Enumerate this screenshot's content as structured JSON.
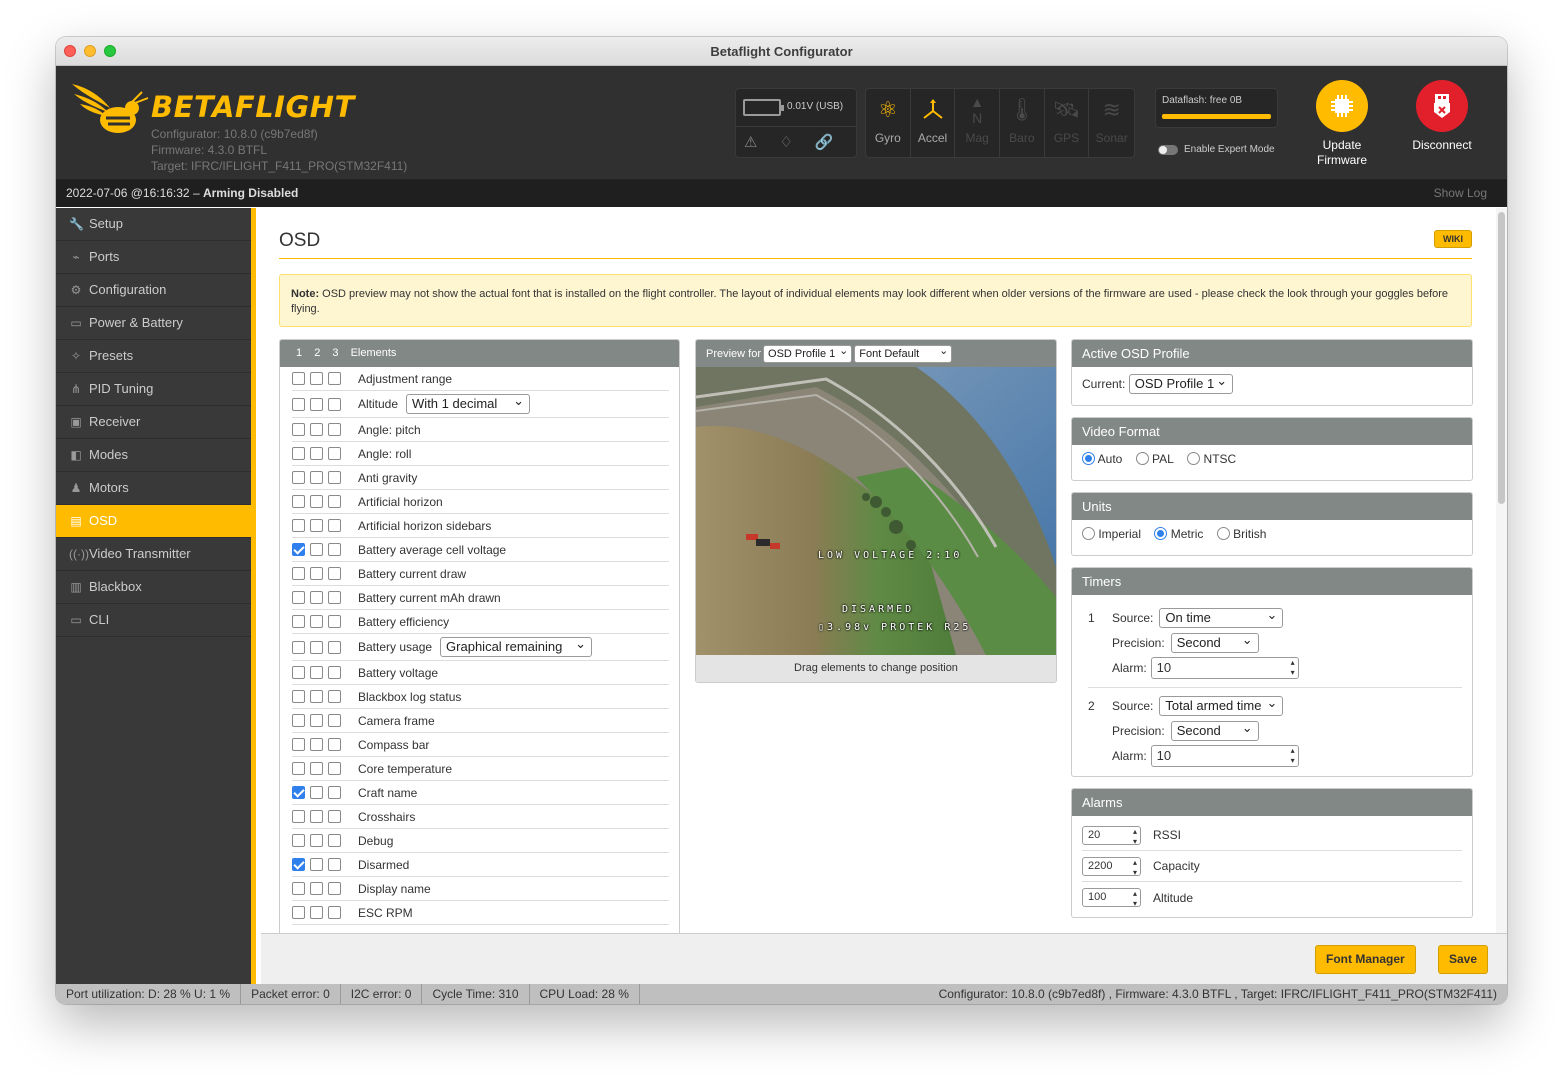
{
  "window": {
    "title": "Betaflight Configurator"
  },
  "header": {
    "brand": "BETAFLIGHT",
    "configurator": "Configurator: 10.8.0 (c9b7ed8f)",
    "firmware": "Firmware: 4.3.0 BTFL",
    "target": "Target: IFRC/IFLIGHT_F411_PRO(STM32F411)",
    "battery": "0.01V (USB)",
    "sensors": [
      {
        "label": "Gyro",
        "icon": "gyro-icon",
        "active": true
      },
      {
        "label": "Accel",
        "icon": "accel-icon",
        "active": true
      },
      {
        "label": "Mag",
        "icon": "mag-icon",
        "active": false
      },
      {
        "label": "Baro",
        "icon": "baro-icon",
        "active": false
      },
      {
        "label": "GPS",
        "icon": "gps-icon",
        "active": false
      },
      {
        "label": "Sonar",
        "icon": "sonar-icon",
        "active": false
      }
    ],
    "dataflash": "Dataflash: free 0B",
    "expert_mode": "Enable Expert Mode",
    "update_firmware": "Update Firmware",
    "disconnect": "Disconnect"
  },
  "logbar": {
    "timestamp": "2022-07-06 @16:16:32 –",
    "status": "Arming Disabled",
    "show_log": "Show Log"
  },
  "sidebar": {
    "items": [
      {
        "label": "Setup",
        "icon": "wrench-icon"
      },
      {
        "label": "Ports",
        "icon": "plug-icon"
      },
      {
        "label": "Configuration",
        "icon": "gear-icon"
      },
      {
        "label": "Power & Battery",
        "icon": "battery-icon"
      },
      {
        "label": "Presets",
        "icon": "magic-icon"
      },
      {
        "label": "PID Tuning",
        "icon": "tree-icon"
      },
      {
        "label": "Receiver",
        "icon": "receiver-icon"
      },
      {
        "label": "Modes",
        "icon": "toggle-icon"
      },
      {
        "label": "Motors",
        "icon": "motor-icon"
      },
      {
        "label": "OSD",
        "icon": "osd-icon",
        "active": true
      },
      {
        "label": "Video Transmitter",
        "icon": "broadcast-icon"
      },
      {
        "label": "Blackbox",
        "icon": "blackbox-icon"
      },
      {
        "label": "CLI",
        "icon": "terminal-icon"
      }
    ]
  },
  "page": {
    "title": "OSD",
    "wiki": "WIKI",
    "note_label": "Note:",
    "note_text": " OSD preview may not show the actual font that is installed on the flight controller. The layout of individual elements may look different when older versions of the firmware are used - please check the look through your goggles before flying."
  },
  "elements": {
    "profiles": [
      "1",
      "2",
      "3"
    ],
    "header": "Elements",
    "items": [
      {
        "label": "Adjustment range",
        "checked": [
          false,
          false,
          false
        ]
      },
      {
        "label": "Altitude",
        "checked": [
          false,
          false,
          false
        ],
        "select": "With 1 decimal"
      },
      {
        "label": "Angle: pitch",
        "checked": [
          false,
          false,
          false
        ]
      },
      {
        "label": "Angle: roll",
        "checked": [
          false,
          false,
          false
        ]
      },
      {
        "label": "Anti gravity",
        "checked": [
          false,
          false,
          false
        ]
      },
      {
        "label": "Artificial horizon",
        "checked": [
          false,
          false,
          false
        ]
      },
      {
        "label": "Artificial horizon sidebars",
        "checked": [
          false,
          false,
          false
        ]
      },
      {
        "label": "Battery average cell voltage",
        "checked": [
          true,
          false,
          false
        ]
      },
      {
        "label": "Battery current draw",
        "checked": [
          false,
          false,
          false
        ]
      },
      {
        "label": "Battery current mAh drawn",
        "checked": [
          false,
          false,
          false
        ]
      },
      {
        "label": "Battery efficiency",
        "checked": [
          false,
          false,
          false
        ]
      },
      {
        "label": "Battery usage",
        "checked": [
          false,
          false,
          false
        ],
        "select": "Graphical remaining"
      },
      {
        "label": "Battery voltage",
        "checked": [
          false,
          false,
          false
        ]
      },
      {
        "label": "Blackbox log status",
        "checked": [
          false,
          false,
          false
        ]
      },
      {
        "label": "Camera frame",
        "checked": [
          false,
          false,
          false
        ]
      },
      {
        "label": "Compass bar",
        "checked": [
          false,
          false,
          false
        ]
      },
      {
        "label": "Core temperature",
        "checked": [
          false,
          false,
          false
        ]
      },
      {
        "label": "Craft name",
        "checked": [
          true,
          false,
          false
        ]
      },
      {
        "label": "Crosshairs",
        "checked": [
          false,
          false,
          false
        ]
      },
      {
        "label": "Debug",
        "checked": [
          false,
          false,
          false
        ]
      },
      {
        "label": "Disarmed",
        "checked": [
          true,
          false,
          false
        ]
      },
      {
        "label": "Display name",
        "checked": [
          false,
          false,
          false
        ]
      },
      {
        "label": "ESC RPM",
        "checked": [
          false,
          false,
          false
        ]
      }
    ]
  },
  "preview": {
    "label": "Preview for",
    "profile_select": "OSD Profile 1",
    "font_select": "Font Default",
    "osd_warning": "LOW VOLTAGE",
    "osd_time": "2:10",
    "osd_disarmed": "DISARMED",
    "osd_voltage": "3.98",
    "osd_craft": "PROTEK R25",
    "footer": "Drag elements to change position"
  },
  "active_profile": {
    "title": "Active OSD Profile",
    "current_label": "Current:",
    "current_value": "OSD Profile 1"
  },
  "video_format": {
    "title": "Video Format",
    "options": [
      "Auto",
      "PAL",
      "NTSC"
    ],
    "selected": 0
  },
  "units": {
    "title": "Units",
    "options": [
      "Imperial",
      "Metric",
      "British"
    ],
    "selected": 1
  },
  "timers": {
    "title": "Timers",
    "source_label": "Source:",
    "precision_label": "Precision:",
    "alarm_label": "Alarm:",
    "items": [
      {
        "num": "1",
        "source": "On time",
        "precision": "Second",
        "alarm": "10"
      },
      {
        "num": "2",
        "source": "Total armed time",
        "precision": "Second",
        "alarm": "10"
      }
    ]
  },
  "alarms": {
    "title": "Alarms",
    "items": [
      {
        "value": "20",
        "label": "RSSI"
      },
      {
        "value": "2200",
        "label": "Capacity"
      },
      {
        "value": "100",
        "label": "Altitude"
      }
    ]
  },
  "actions": {
    "font_manager": "Font Manager",
    "save": "Save"
  },
  "status": {
    "port": "Port utilization: D: 28 % U: 1 %",
    "packet": "Packet error: 0",
    "i2c": "I2C error: 0",
    "cycle": "Cycle Time: 310",
    "cpu": "CPU Load: 28 %",
    "version": "Configurator: 10.8.0 (c9b7ed8f) , Firmware: 4.3.0 BTFL , Target: IFRC/IFLIGHT_F411_PRO(STM32F411)"
  },
  "colors": {
    "accent": "#ffbb00",
    "header_bg": "#303030",
    "sidebar_bg": "#393939",
    "disconnect": "#e2202c",
    "checkbox": "#2f80ed"
  }
}
